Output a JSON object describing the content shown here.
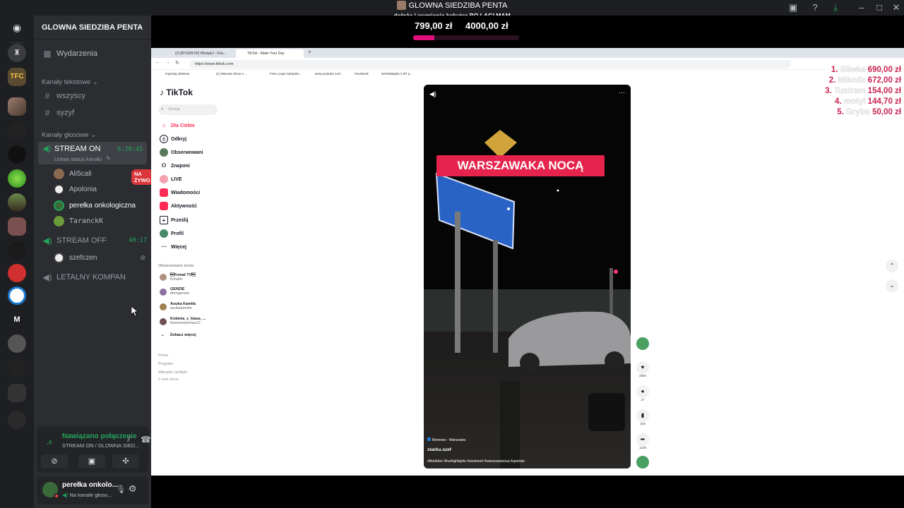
{
  "window": {
    "title": "GLOWNA SIEDZIBA PENTA",
    "subtitle": "dołożę i wymienię kąkuter BO LAGI MAM"
  },
  "goal": {
    "current": "799,00 zł",
    "target": "4000,00 zł",
    "progress": 0.2
  },
  "server": {
    "name": "GLOWNA SIEDZIBA PENTA",
    "events_label": "Wydarzenia"
  },
  "text_category": "Kanały tekstowe",
  "text_channels": [
    "wszyscy",
    "syzyf"
  ],
  "voice_category": "Kanały głosowe",
  "voice_channels": [
    {
      "name": "STREAM ON",
      "time": "6:28:45",
      "status": "Ustaw status kanału"
    },
    {
      "name": "STREAM OFF",
      "time": "40:17"
    },
    {
      "name": "LETALNY KOMPAN"
    }
  ],
  "stream_on_users": [
    {
      "name": "Ali5cali",
      "badge": "NA ŻYWO"
    },
    {
      "name": "Apolonia"
    },
    {
      "name": "perełka onkologiczna"
    },
    {
      "name": "TaranckK"
    }
  ],
  "stream_off_users": [
    {
      "name": "szefczen"
    }
  ],
  "voice_panel": {
    "status": "Nawiązano połączenie",
    "channel": "STREAM ON / GLOWNA SIED..."
  },
  "user_panel": {
    "name": "perełka onkolo...",
    "status": "Na kanale głoso..."
  },
  "browser": {
    "tabs": [
      "(2) [RYGPA 5F] Mlody&J - Dos...",
      "TikTok - Make Your Day"
    ],
    "url": "https://www.tiktok.com",
    "bookmarks": [
      "Importuj ulubione",
      "(1) Warsaw Show 1...",
      "Free Loops Samples...",
      "www.youtube.com",
      "Facebook",
      "MATeMatyka 2 ZP p..."
    ]
  },
  "tiktok": {
    "logo": "TikTok",
    "search_placeholder": "Szukaj",
    "nav": [
      "Dla Ciebie",
      "Odkryj",
      "Obserwowani",
      "Znajomi",
      "LIVE",
      "Wiadomości",
      "Aktywność",
      "Prześlij",
      "Profil",
      "Więcej"
    ],
    "followed_heading": "Obserwowane konta",
    "accounts": [
      {
        "handle": "\u0007Fomal TV\u0007",
        "name": "fomaltv"
      },
      {
        "handle": "GENZIE",
        "name": "domgenzie"
      },
      {
        "handle": "Asuka Kamila",
        "name": "asukakamila"
      },
      {
        "handle": "Kobieta_z_klasa_...",
        "name": "biznesowoman12"
      }
    ],
    "see_more": "Zobacz więcej",
    "footer": [
      "Firma",
      "Program",
      "Warunki i polityki",
      "© 2025 TikTok"
    ],
    "video": {
      "caption": "WARSZAWAKA NOCĄ",
      "location": "Bemowo - Warszawa",
      "user": "starku.szef",
      "hashtags": "#tiktoklive #livehighlights #weekend #warszawanocą #spontan"
    },
    "counts": {
      "likes": "2694",
      "comments": "27",
      "saves": "348",
      "shares": "1229"
    }
  },
  "leaderboard": [
    {
      "rank": "1.",
      "name": "Sliwka",
      "amount": "690,00 zł"
    },
    {
      "rank": "2.",
      "name": "Mikodz",
      "amount": "672,00 zł"
    },
    {
      "rank": "3.",
      "name": "Tustram",
      "amount": "154,00 zł"
    },
    {
      "rank": "4.",
      "name": "motyl",
      "amount": "144,70 zł"
    },
    {
      "rank": "5.",
      "name": "Grybu",
      "amount": "50,00 zł"
    }
  ]
}
